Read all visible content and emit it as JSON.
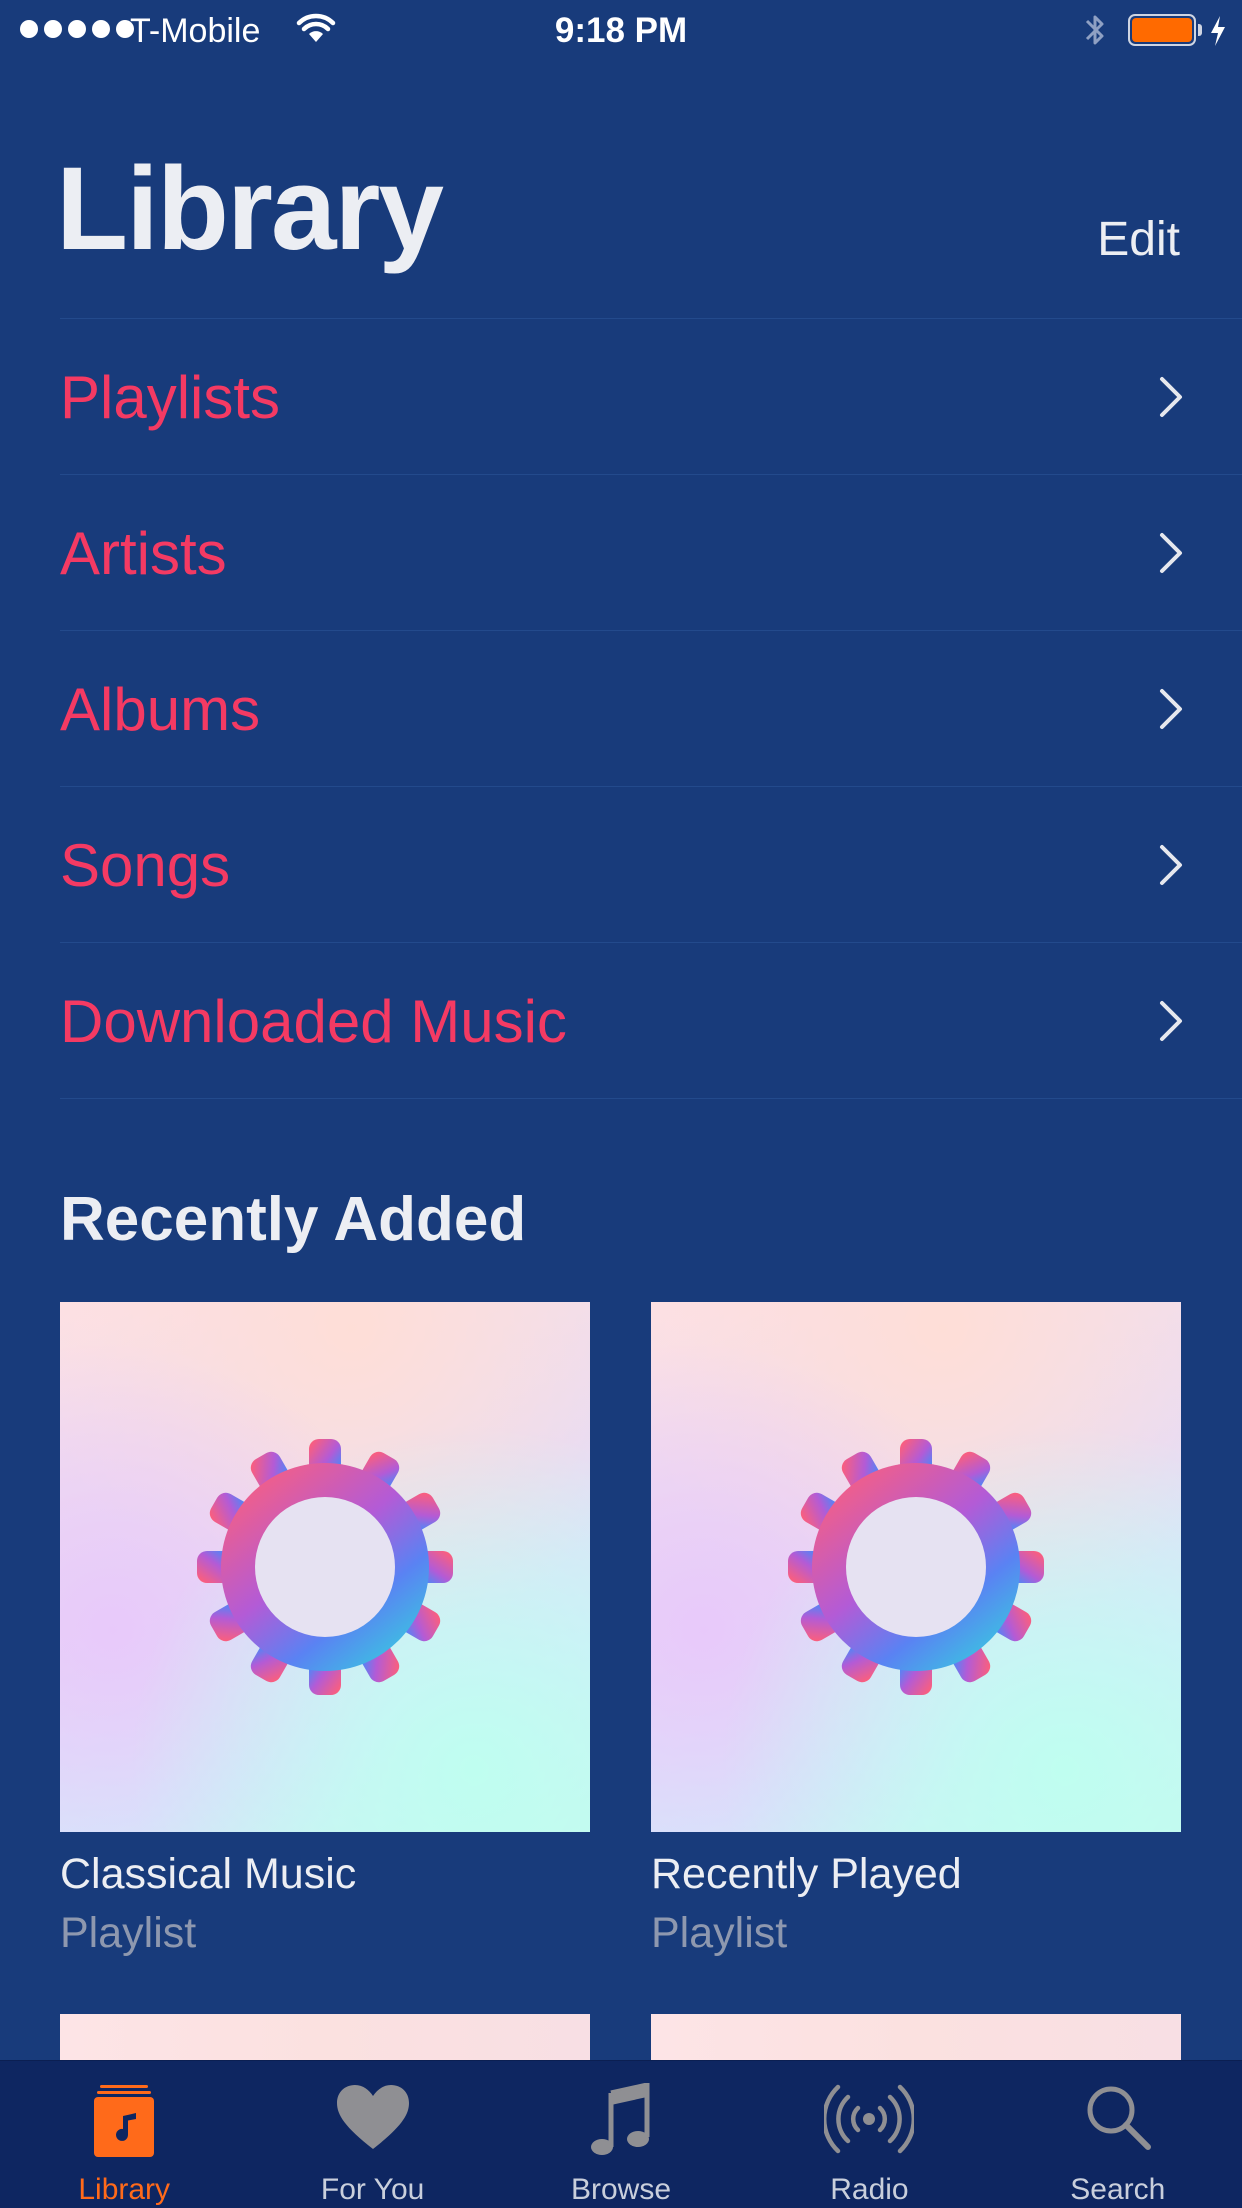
{
  "status_bar": {
    "carrier": "T-Mobile",
    "time": "9:18 PM",
    "signal_bars": 5,
    "battery_color": "#ff6a00"
  },
  "header": {
    "title": "Library",
    "edit_label": "Edit"
  },
  "library_items": [
    {
      "label": "Playlists"
    },
    {
      "label": "Artists"
    },
    {
      "label": "Albums"
    },
    {
      "label": "Songs"
    },
    {
      "label": "Downloaded Music"
    }
  ],
  "recently_added": {
    "title": "Recently Added",
    "items": [
      {
        "title": "Classical Music",
        "subtitle": "Playlist",
        "icon": "gear-icon"
      },
      {
        "title": "Recently Played",
        "subtitle": "Playlist",
        "icon": "gear-icon"
      }
    ]
  },
  "tab_bar": {
    "tabs": [
      {
        "label": "Library",
        "icon": "library-icon",
        "active": true
      },
      {
        "label": "For You",
        "icon": "heart-icon",
        "active": false
      },
      {
        "label": "Browse",
        "icon": "music-note-icon",
        "active": false
      },
      {
        "label": "Radio",
        "icon": "radio-icon",
        "active": false
      },
      {
        "label": "Search",
        "icon": "search-icon",
        "active": false
      }
    ]
  },
  "colors": {
    "background": "#183b7b",
    "accent": "#f43a63",
    "tab_active": "#ff6a1a",
    "tab_bar": "#0e2661"
  }
}
